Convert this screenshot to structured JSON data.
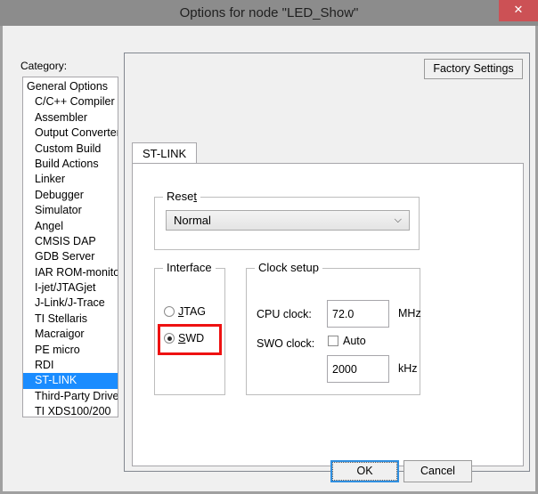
{
  "window": {
    "title": "Options for node \"LED_Show\"",
    "close_icon": "close-icon",
    "close_glyph": "✕",
    "titlebar_color": "#8c8c8c",
    "close_color": "#cc5155"
  },
  "category": {
    "label": "Category:",
    "items": [
      {
        "label": "General Options",
        "indent": false,
        "selected": false
      },
      {
        "label": "C/C++ Compiler",
        "indent": true,
        "selected": false
      },
      {
        "label": "Assembler",
        "indent": true,
        "selected": false
      },
      {
        "label": "Output Converter",
        "indent": true,
        "selected": false
      },
      {
        "label": "Custom Build",
        "indent": true,
        "selected": false
      },
      {
        "label": "Build Actions",
        "indent": true,
        "selected": false
      },
      {
        "label": "Linker",
        "indent": true,
        "selected": false
      },
      {
        "label": "Debugger",
        "indent": true,
        "selected": false
      },
      {
        "label": "Simulator",
        "indent": true,
        "selected": false
      },
      {
        "label": "Angel",
        "indent": true,
        "selected": false
      },
      {
        "label": "CMSIS DAP",
        "indent": true,
        "selected": false
      },
      {
        "label": "GDB Server",
        "indent": true,
        "selected": false
      },
      {
        "label": "IAR ROM-monitor",
        "indent": true,
        "selected": false
      },
      {
        "label": "I-jet/JTAGjet",
        "indent": true,
        "selected": false
      },
      {
        "label": "J-Link/J-Trace",
        "indent": true,
        "selected": false
      },
      {
        "label": "TI Stellaris",
        "indent": true,
        "selected": false
      },
      {
        "label": "Macraigor",
        "indent": true,
        "selected": false
      },
      {
        "label": "PE micro",
        "indent": true,
        "selected": false
      },
      {
        "label": "RDI",
        "indent": true,
        "selected": false
      },
      {
        "label": "ST-LINK",
        "indent": true,
        "selected": true
      },
      {
        "label": "Third-Party Driver",
        "indent": true,
        "selected": false
      },
      {
        "label": "TI XDS100/200",
        "indent": true,
        "selected": false
      }
    ],
    "selection_color": "#1a8cff"
  },
  "main": {
    "factory_settings_label": "Factory Settings",
    "tabs": [
      {
        "label": "ST-LINK",
        "active": true
      }
    ],
    "reset": {
      "title": "Reset",
      "title_pre": "Rese",
      "title_accel": "t",
      "selected_value": "Normal",
      "arrow_glyph": "⌵"
    },
    "interface": {
      "title": "Interface",
      "options": [
        {
          "pre": "",
          "accel": "J",
          "post": "TAG",
          "label": "JTAG",
          "checked": false
        },
        {
          "pre": "",
          "accel": "S",
          "post": "WD",
          "label": "SWD",
          "checked": true
        }
      ],
      "highlight_color": "#ee1111",
      "highlight_target": "SWD"
    },
    "clock_setup": {
      "title": "Clock setup",
      "cpu_clock_label": "CPU clock:",
      "cpu_clock_value": "72.0",
      "cpu_clock_unit": "MHz",
      "swo_clock_label": "SWO clock:",
      "swo_auto_label": "Auto",
      "swo_auto_checked": false,
      "swo_clock_value": "2000",
      "swo_clock_unit": "kHz"
    }
  },
  "footer": {
    "ok_label": "OK",
    "cancel_label": "Cancel"
  }
}
